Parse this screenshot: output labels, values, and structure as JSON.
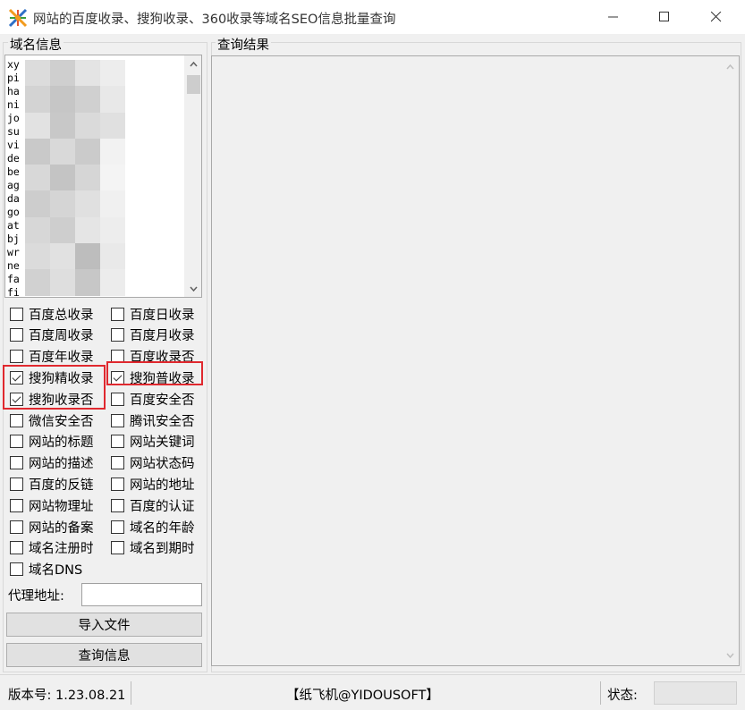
{
  "window": {
    "title": "网站的百度收录、搜狗收录、360收录等域名SEO信息批量查询"
  },
  "domain_panel": {
    "title": "域名信息",
    "list_visible_text": [
      "xy",
      "pi    .com",
      "ha",
      "ni",
      "jo     m",
      "su     m",
      "vi    .om",
      "de",
      "be",
      "ag",
      "da     com",
      "go     com",
      "at     com",
      "bj",
      "wr     m",
      "ne     com",
      "fa     m",
      "fi"
    ]
  },
  "result_panel": {
    "title": "查询结果"
  },
  "options": [
    {
      "label": "百度总收录",
      "checked": false
    },
    {
      "label": "百度日收录",
      "checked": false
    },
    {
      "label": "百度周收录",
      "checked": false
    },
    {
      "label": "百度月收录",
      "checked": false
    },
    {
      "label": "百度年收录",
      "checked": false
    },
    {
      "label": "百度收录否",
      "checked": false
    },
    {
      "label": "搜狗精收录",
      "checked": true
    },
    {
      "label": "搜狗普收录",
      "checked": true
    },
    {
      "label": "搜狗收录否",
      "checked": true
    },
    {
      "label": "百度安全否",
      "checked": false
    },
    {
      "label": "微信安全否",
      "checked": false
    },
    {
      "label": "腾讯安全否",
      "checked": false
    },
    {
      "label": "网站的标题",
      "checked": false
    },
    {
      "label": "网站关键词",
      "checked": false
    },
    {
      "label": "网站的描述",
      "checked": false
    },
    {
      "label": "网站状态码",
      "checked": false
    },
    {
      "label": "百度的反链",
      "checked": false
    },
    {
      "label": "网站的地址",
      "checked": false
    },
    {
      "label": "网站物理址",
      "checked": false
    },
    {
      "label": "百度的认证",
      "checked": false
    },
    {
      "label": "网站的备案",
      "checked": false
    },
    {
      "label": "域名的年龄",
      "checked": false
    },
    {
      "label": "域名注册时",
      "checked": false
    },
    {
      "label": "域名到期时",
      "checked": false
    },
    {
      "label": "域名DNS",
      "checked": false
    }
  ],
  "proxy": {
    "label": "代理地址:",
    "value": ""
  },
  "buttons": {
    "import": "导入文件",
    "query": "查询信息"
  },
  "statusbar": {
    "version": "版本号: 1.23.08.21",
    "company": "【纸飞机@YIDOUSOFT】",
    "status_label": "状态:",
    "status_value": ""
  },
  "colors": {
    "highlight": "#e0282e",
    "window_bg": "#f0f0f0"
  }
}
